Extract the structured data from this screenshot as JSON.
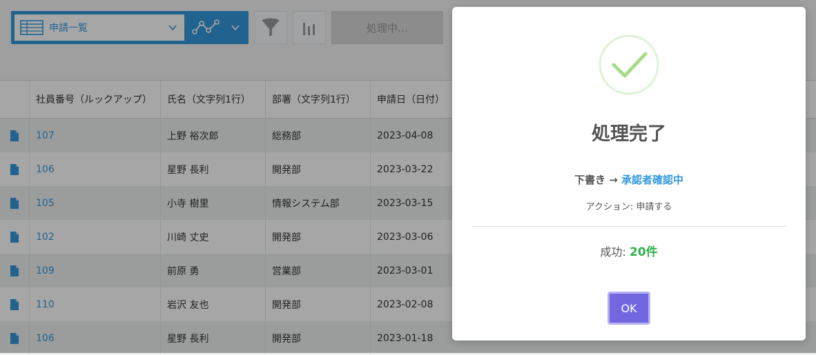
{
  "toolbar": {
    "view_name": "申請一覧",
    "processing_label": "処理中…",
    "accent_color": "#3498db"
  },
  "table": {
    "headers": [
      "",
      "社員番号（ルックアップ）",
      "氏名（文字列1行）",
      "部署（文字列1行）",
      "申請日（日付）"
    ],
    "rows": [
      {
        "emp_no": "107",
        "name": "上野 裕次郎",
        "dept": "総務部",
        "date": "2023-04-08"
      },
      {
        "emp_no": "106",
        "name": "星野 長利",
        "dept": "開発部",
        "date": "2023-03-22"
      },
      {
        "emp_no": "105",
        "name": "小寺 樹里",
        "dept": "情報システム部",
        "date": "2023-03-15"
      },
      {
        "emp_no": "102",
        "name": "川崎 丈史",
        "dept": "開発部",
        "date": "2023-03-06"
      },
      {
        "emp_no": "109",
        "name": "前原 勇",
        "dept": "営業部",
        "date": "2023-03-01"
      },
      {
        "emp_no": "110",
        "name": "岩沢 友也",
        "dept": "開発部",
        "date": "2023-02-08"
      },
      {
        "emp_no": "106",
        "name": "星野 長利",
        "dept": "開発部",
        "date": "2023-01-18"
      }
    ]
  },
  "dialog": {
    "title": "処理完了",
    "status_from": "下書き",
    "arrow": "→",
    "status_to": "承認者確認中",
    "action_text": "アクション: 申請する",
    "result_label": "成功:",
    "result_count": "20件",
    "ok_label": "OK",
    "success_color": "#2db34a",
    "button_color": "#7367e0"
  }
}
